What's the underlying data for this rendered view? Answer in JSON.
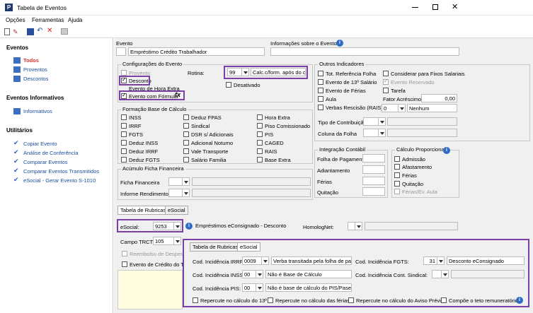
{
  "window": {
    "title": "Tabela de Eventos"
  },
  "menu": [
    "Opções",
    "Ferramentas",
    "Ajuda"
  ],
  "sidebar": {
    "eventos_title": "Eventos",
    "eventos": [
      "Todos",
      "Proventos",
      "Descontos"
    ],
    "informativos_title": "Eventos Informativos",
    "informativos": [
      "Informativos"
    ],
    "utilitarios_title": "Utilitários",
    "utilitarios": [
      "Copiar Evento",
      "Análise de Conferência",
      "Comparar Eventos",
      "Comparar Eventos Transmitidos",
      "eSocial - Gerar Evento S-1010"
    ]
  },
  "evento": {
    "label": "Evento",
    "name": "Empréstimo Crédito Trabalhador",
    "info_label": "Informações sobre o Evento"
  },
  "config": {
    "title": "Configurações do Evento",
    "provento": "Provento",
    "desconto": "Desconto",
    "hora_extra": "Evento de Hora Extra",
    "formula": "Evento com Fórmula",
    "rotina_label": "Rotina:",
    "rotina_code": "99",
    "rotina_desc": "Calc.c/form. após do cal",
    "desativado": "Desativado"
  },
  "outros": {
    "title": "Outros Indicadores",
    "items": [
      "Tot. Referência Folha",
      "Evento de 13º Salário",
      "Evento de Férias",
      "Aula",
      "Verbas Rescisão (RAIS)"
    ],
    "items2": [
      "Considerar para Fixos Salariais",
      "Evento Reservado",
      "Tarefa"
    ],
    "fator_label": "Fator Acréscimo",
    "fator_value": "0,00",
    "rescisao_code": "0",
    "rescisao_desc": "Nenhum",
    "tipo_contrib": "Tipo de Contribuição",
    "coluna_folha": "Coluna da Folha"
  },
  "base": {
    "title": "Formação Base de Cálculo",
    "col1": [
      "INSS",
      "IRRF",
      "FGTS",
      "Deduz INSS",
      "Deduz IRRF",
      "Deduz FGTS"
    ],
    "col2": [
      "Deduz FPAS",
      "Sindical",
      "DSR s/ Adicionais",
      "Adicional Noturno",
      "Vale Transporte",
      "Salário Familia"
    ],
    "col3": [
      "Hora Extra",
      "Piso Comissionado",
      "PIS",
      "CAGED",
      "RAIS",
      "Base Extra"
    ]
  },
  "integracao": {
    "title": "Integração Contábil",
    "items": [
      "Folha de Pagamento",
      "Adiantamento",
      "Férias",
      "Quitação"
    ]
  },
  "proporcional": {
    "title": "Cálculo Proporcional",
    "items": [
      "Admissão",
      "Afastamento",
      "Férias",
      "Quitação",
      "Férias/Ev. Aula"
    ]
  },
  "acumulo": {
    "title": "Acúmulo Ficha Financeira",
    "items": [
      "Ficha Financeira",
      "Informe Rendimentos"
    ]
  },
  "tabs": [
    "Tabela de Rubricas",
    "eSocial"
  ],
  "esocial": {
    "label": "eSocial:",
    "code": "9253",
    "desc": "Empréstimos eConsignado - Desconto",
    "homolog": "HomologNet:",
    "trct_label": "Campo TRCT:",
    "trct_value": "105",
    "reembolso": "Reembolso de Despesas F",
    "credito": "Evento de Crédito do Trab"
  },
  "popup": {
    "tabs": [
      "Tabela de Rubricas",
      "eSocial"
    ],
    "irrf_label": "Cod. Incidência IRRF:",
    "irrf_code": "0009",
    "irrf_desc": "Verba transitada pela folha de pagai",
    "inss_label": "Cod. Incidência INSS:",
    "inss_code": "00",
    "inss_desc": "Não é Base de Cálculo",
    "pis_label": "Cod. Incidência PIS:",
    "pis_code": "00",
    "pis_desc": "Não é base de cálculo do PIS/Pasep",
    "fgts_label": "Cod. Incidência FGTS:",
    "fgts_code": "31",
    "fgts_desc": "Desconto eConsignado",
    "sind_label": "Cod. Incidência Cont. Sindical:",
    "checks": [
      "Repercute no cálculo do 13º",
      "Repercute no cálculo das férias",
      "Repercute no cálculo do Aviso Prévio",
      "Compõe o teto remuneratório"
    ]
  },
  "colors": {
    "accent": "#7b3fa8",
    "link": "#1a4fa0",
    "active": "#e03030"
  }
}
